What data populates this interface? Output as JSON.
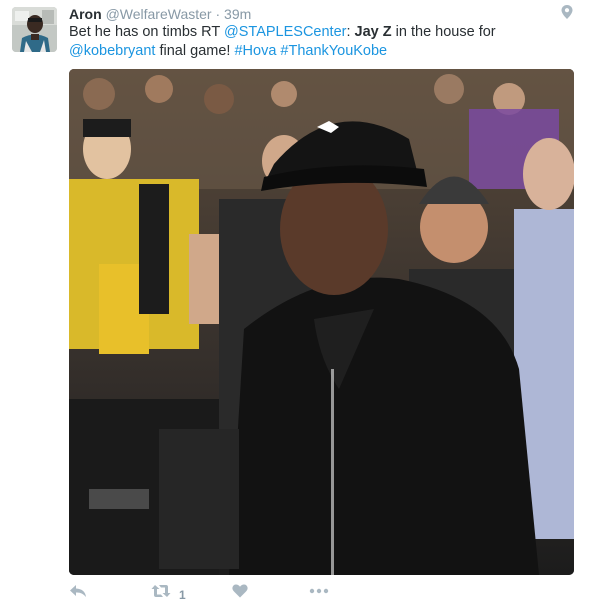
{
  "tweet": {
    "name": "Aron",
    "handle": "@WelfareWaster",
    "separator": "·",
    "time": "39m",
    "text": {
      "part1": "Bet he has on timbs RT ",
      "mention1": "@STAPLESCenter",
      "part2": ": ",
      "bold1": "Jay Z",
      "part3": " in the house for ",
      "mention2": "@kobebryant",
      "part4": " final game! ",
      "hashtag1": "#Hova",
      "part5": " ",
      "hashtag2": "#ThankYouKobe"
    },
    "media_alt": "photo",
    "avatar_caption": "Chloe"
  },
  "actions": {
    "reply_icon": "reply-icon",
    "retweet_icon": "retweet-icon",
    "retweet_count": "1",
    "like_icon": "heart-icon",
    "more_icon": "more-dots-icon"
  },
  "colors": {
    "link": "#1b95e0",
    "text": "#292f33",
    "muted": "#8899a6",
    "icon": "#aab8c2"
  }
}
